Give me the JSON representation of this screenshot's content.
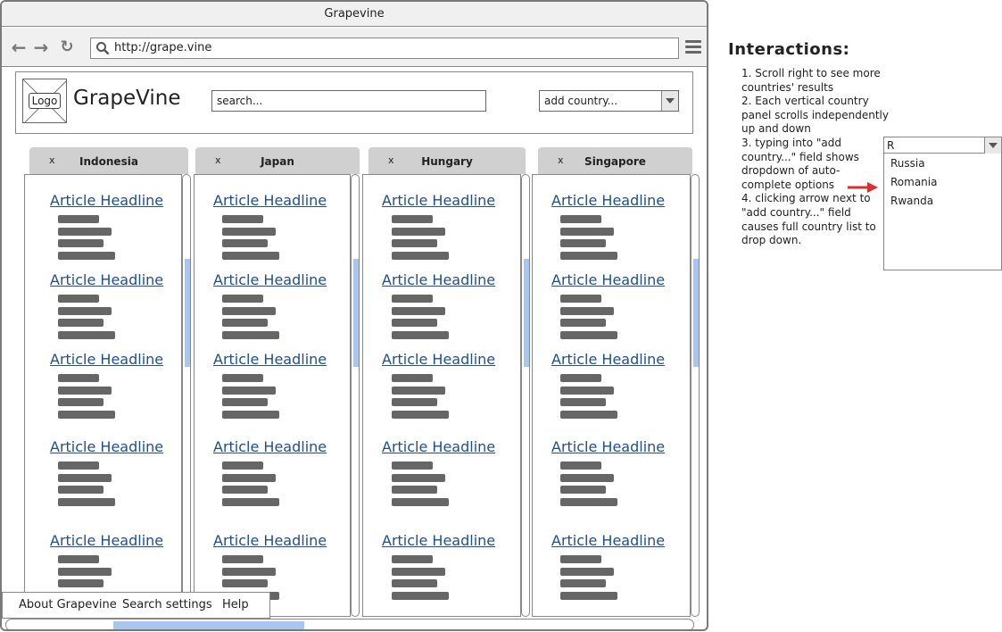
{
  "browser": {
    "title": "Grapevine",
    "url": "http://grape.vine"
  },
  "header": {
    "logo_label": "Logo",
    "app_name": "GrapeVine",
    "search_placeholder": "search...",
    "add_country_placeholder": "add country..."
  },
  "panels": [
    {
      "close": "x",
      "country": "Indonesia"
    },
    {
      "close": "x",
      "country": "Japan"
    },
    {
      "close": "x",
      "country": "Hungary"
    },
    {
      "close": "x",
      "country": "Singapore"
    }
  ],
  "article_headline": "Article Headline",
  "footer": {
    "about": "About Grapevine",
    "search_settings": "Search settings",
    "help": "Help"
  },
  "annotations": {
    "title": "Interactions:",
    "lines": [
      "1. Scroll right to see more",
      "countries' results",
      "2. Each vertical country",
      "panel scrolls independently",
      "up and down",
      "3. typing into \"add",
      "country...\" field shows",
      "dropdown of auto-",
      "complete options",
      "4. clicking arrow next to",
      "\"add country...\" field",
      "causes full country list to",
      "drop down."
    ],
    "dropdown_value": "R",
    "dropdown_options": [
      "Russia",
      "Romania",
      "Rwanda"
    ]
  },
  "colors": {
    "link": "#1f4f8f",
    "scroll_thumb": "#a8c6ef",
    "tab_bg": "#d0d0d0",
    "arrow": "#d9302f"
  }
}
